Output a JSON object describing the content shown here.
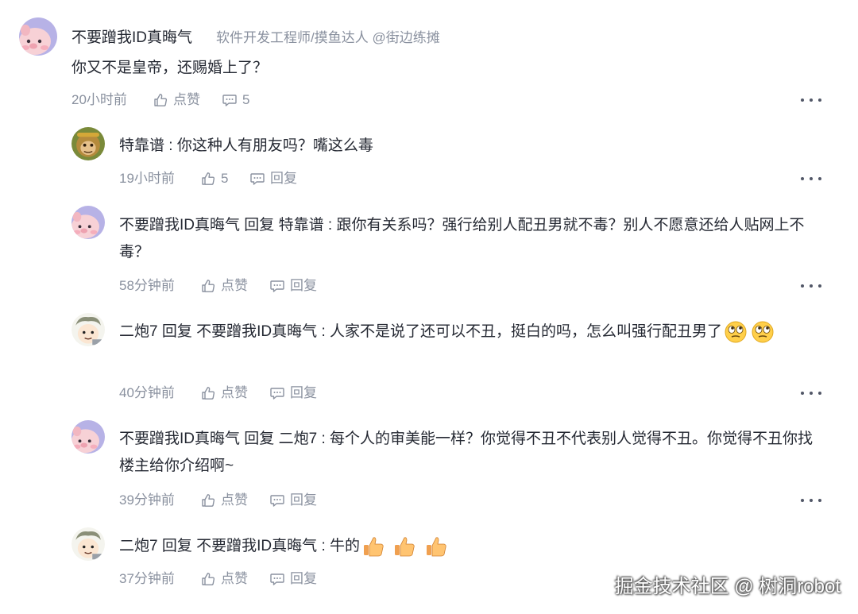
{
  "comment": {
    "author": "不要蹭我ID真晦气",
    "author_title": "软件开发工程师/摸鱼达人 @街边练摊",
    "text": "你又不是皇帝，还赐婚上了？",
    "time": "20小时前",
    "like_label": "点赞",
    "reply_count": "5"
  },
  "replies": [
    {
      "author": "特靠谱",
      "reply_word": "",
      "reply_to": "",
      "separator": " : ",
      "text": "你这种人有朋友吗？嘴这么毒",
      "time": "19小时前",
      "like_label": "5",
      "reply_label": "回复",
      "avatar_icon": "monkey-avatar"
    },
    {
      "author": "不要蹭我ID真晦气",
      "reply_word": "回复",
      "reply_to": "特靠谱",
      "separator": " : ",
      "text": "跟你有关系吗？强行给别人配丑男就不毒？别人不愿意还给人贴网上不毒？",
      "time": "58分钟前",
      "like_label": "点赞",
      "reply_label": "回复",
      "avatar_icon": "pig-avatar"
    },
    {
      "author": "二炮7",
      "reply_word": "回复",
      "reply_to": "不要蹭我ID真晦气",
      "separator": " : ",
      "text": "人家不是说了还可以不丑，挺白的吗，怎么叫强行配丑男了",
      "emojis": [
        "eye-roll-emoji",
        "eye-roll-emoji"
      ],
      "time": "40分钟前",
      "like_label": "点赞",
      "reply_label": "回复",
      "avatar_icon": "cartoon-avatar"
    },
    {
      "author": "不要蹭我ID真晦气",
      "reply_word": "回复",
      "reply_to": "二炮7",
      "separator": " : ",
      "text": "每个人的审美能一样？你觉得不丑不代表别人觉得不丑。你觉得不丑你找楼主给你介绍啊~",
      "time": "39分钟前",
      "like_label": "点赞",
      "reply_label": "回复",
      "avatar_icon": "pig-avatar"
    },
    {
      "author": "二炮7",
      "reply_word": "回复",
      "reply_to": "不要蹭我ID真晦气",
      "separator": " : ",
      "text": "牛的",
      "emojis": [
        "thumbs-up-emoji",
        "thumbs-up-emoji",
        "thumbs-up-emoji"
      ],
      "time": "37分钟前",
      "like_label": "点赞",
      "reply_label": "回复",
      "avatar_icon": "cartoon-avatar"
    }
  ],
  "watermark": "掘金技术社区 @ 树洞robot",
  "colors": {
    "text": "#252933",
    "muted": "#8a919f",
    "pig_bg": "#b7b2e6",
    "pig_face": "#f7c6cf"
  }
}
